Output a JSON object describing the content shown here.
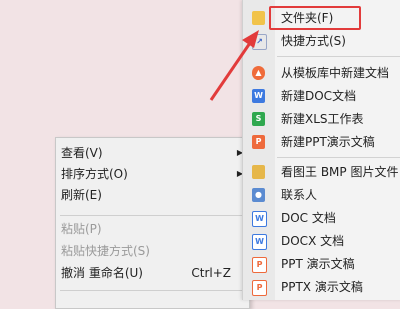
{
  "context_menu": {
    "items": [
      {
        "label": "查看(V)",
        "has_submenu": true
      },
      {
        "label": "排序方式(O)",
        "has_submenu": true
      },
      {
        "label": "刷新(E)"
      },
      {
        "label": "粘贴(P)",
        "disabled": true
      },
      {
        "label": "粘贴快捷方式(S)",
        "disabled": true
      },
      {
        "label": "撤消 重命名(U)",
        "shortcut": "Ctrl+Z"
      }
    ]
  },
  "sub_menu": {
    "items": [
      {
        "label": "文件夹(F)",
        "icon": "folder-icon"
      },
      {
        "label": "快捷方式(S)",
        "icon": "shortcut-icon"
      },
      {
        "label": "从模板库中新建文档",
        "icon": "wps-template-icon"
      },
      {
        "label": "新建DOC文档",
        "icon": "doc-icon"
      },
      {
        "label": "新建XLS工作表",
        "icon": "xls-icon"
      },
      {
        "label": "新建PPT演示文稿",
        "icon": "ppt-icon"
      },
      {
        "label": "看图王 BMP 图片文件",
        "icon": "bmp-image-icon"
      },
      {
        "label": "联系人",
        "icon": "contact-icon"
      },
      {
        "label": "DOC 文档",
        "icon": "doc-file-icon"
      },
      {
        "label": "DOCX 文档",
        "icon": "docx-file-icon"
      },
      {
        "label": "PPT 演示文稿",
        "icon": "ppt-file-icon"
      },
      {
        "label": "PPTX 演示文稿",
        "icon": "pptx-file-icon"
      }
    ]
  },
  "colors": {
    "highlight": "#e23b3b",
    "background": "#f2e3e5"
  }
}
